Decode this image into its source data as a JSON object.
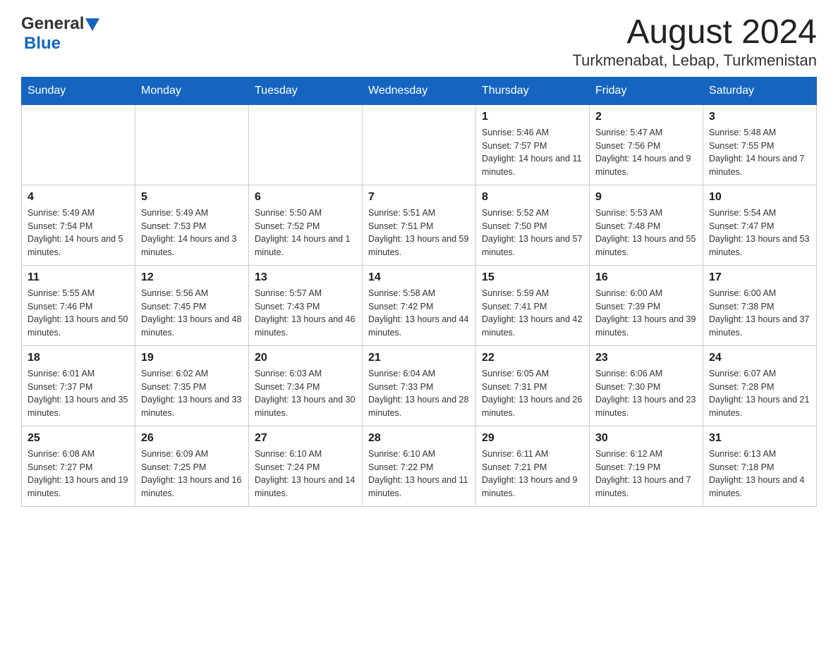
{
  "header": {
    "logo_general": "General",
    "logo_blue": "Blue",
    "month_title": "August 2024",
    "location": "Turkmenabat, Lebap, Turkmenistan"
  },
  "days_of_week": [
    "Sunday",
    "Monday",
    "Tuesday",
    "Wednesday",
    "Thursday",
    "Friday",
    "Saturday"
  ],
  "weeks": [
    {
      "days": [
        {
          "num": "",
          "info": ""
        },
        {
          "num": "",
          "info": ""
        },
        {
          "num": "",
          "info": ""
        },
        {
          "num": "",
          "info": ""
        },
        {
          "num": "1",
          "info": "Sunrise: 5:46 AM\nSunset: 7:57 PM\nDaylight: 14 hours and 11 minutes."
        },
        {
          "num": "2",
          "info": "Sunrise: 5:47 AM\nSunset: 7:56 PM\nDaylight: 14 hours and 9 minutes."
        },
        {
          "num": "3",
          "info": "Sunrise: 5:48 AM\nSunset: 7:55 PM\nDaylight: 14 hours and 7 minutes."
        }
      ]
    },
    {
      "days": [
        {
          "num": "4",
          "info": "Sunrise: 5:49 AM\nSunset: 7:54 PM\nDaylight: 14 hours and 5 minutes."
        },
        {
          "num": "5",
          "info": "Sunrise: 5:49 AM\nSunset: 7:53 PM\nDaylight: 14 hours and 3 minutes."
        },
        {
          "num": "6",
          "info": "Sunrise: 5:50 AM\nSunset: 7:52 PM\nDaylight: 14 hours and 1 minute."
        },
        {
          "num": "7",
          "info": "Sunrise: 5:51 AM\nSunset: 7:51 PM\nDaylight: 13 hours and 59 minutes."
        },
        {
          "num": "8",
          "info": "Sunrise: 5:52 AM\nSunset: 7:50 PM\nDaylight: 13 hours and 57 minutes."
        },
        {
          "num": "9",
          "info": "Sunrise: 5:53 AM\nSunset: 7:48 PM\nDaylight: 13 hours and 55 minutes."
        },
        {
          "num": "10",
          "info": "Sunrise: 5:54 AM\nSunset: 7:47 PM\nDaylight: 13 hours and 53 minutes."
        }
      ]
    },
    {
      "days": [
        {
          "num": "11",
          "info": "Sunrise: 5:55 AM\nSunset: 7:46 PM\nDaylight: 13 hours and 50 minutes."
        },
        {
          "num": "12",
          "info": "Sunrise: 5:56 AM\nSunset: 7:45 PM\nDaylight: 13 hours and 48 minutes."
        },
        {
          "num": "13",
          "info": "Sunrise: 5:57 AM\nSunset: 7:43 PM\nDaylight: 13 hours and 46 minutes."
        },
        {
          "num": "14",
          "info": "Sunrise: 5:58 AM\nSunset: 7:42 PM\nDaylight: 13 hours and 44 minutes."
        },
        {
          "num": "15",
          "info": "Sunrise: 5:59 AM\nSunset: 7:41 PM\nDaylight: 13 hours and 42 minutes."
        },
        {
          "num": "16",
          "info": "Sunrise: 6:00 AM\nSunset: 7:39 PM\nDaylight: 13 hours and 39 minutes."
        },
        {
          "num": "17",
          "info": "Sunrise: 6:00 AM\nSunset: 7:38 PM\nDaylight: 13 hours and 37 minutes."
        }
      ]
    },
    {
      "days": [
        {
          "num": "18",
          "info": "Sunrise: 6:01 AM\nSunset: 7:37 PM\nDaylight: 13 hours and 35 minutes."
        },
        {
          "num": "19",
          "info": "Sunrise: 6:02 AM\nSunset: 7:35 PM\nDaylight: 13 hours and 33 minutes."
        },
        {
          "num": "20",
          "info": "Sunrise: 6:03 AM\nSunset: 7:34 PM\nDaylight: 13 hours and 30 minutes."
        },
        {
          "num": "21",
          "info": "Sunrise: 6:04 AM\nSunset: 7:33 PM\nDaylight: 13 hours and 28 minutes."
        },
        {
          "num": "22",
          "info": "Sunrise: 6:05 AM\nSunset: 7:31 PM\nDaylight: 13 hours and 26 minutes."
        },
        {
          "num": "23",
          "info": "Sunrise: 6:06 AM\nSunset: 7:30 PM\nDaylight: 13 hours and 23 minutes."
        },
        {
          "num": "24",
          "info": "Sunrise: 6:07 AM\nSunset: 7:28 PM\nDaylight: 13 hours and 21 minutes."
        }
      ]
    },
    {
      "days": [
        {
          "num": "25",
          "info": "Sunrise: 6:08 AM\nSunset: 7:27 PM\nDaylight: 13 hours and 19 minutes."
        },
        {
          "num": "26",
          "info": "Sunrise: 6:09 AM\nSunset: 7:25 PM\nDaylight: 13 hours and 16 minutes."
        },
        {
          "num": "27",
          "info": "Sunrise: 6:10 AM\nSunset: 7:24 PM\nDaylight: 13 hours and 14 minutes."
        },
        {
          "num": "28",
          "info": "Sunrise: 6:10 AM\nSunset: 7:22 PM\nDaylight: 13 hours and 11 minutes."
        },
        {
          "num": "29",
          "info": "Sunrise: 6:11 AM\nSunset: 7:21 PM\nDaylight: 13 hours and 9 minutes."
        },
        {
          "num": "30",
          "info": "Sunrise: 6:12 AM\nSunset: 7:19 PM\nDaylight: 13 hours and 7 minutes."
        },
        {
          "num": "31",
          "info": "Sunrise: 6:13 AM\nSunset: 7:18 PM\nDaylight: 13 hours and 4 minutes."
        }
      ]
    }
  ]
}
